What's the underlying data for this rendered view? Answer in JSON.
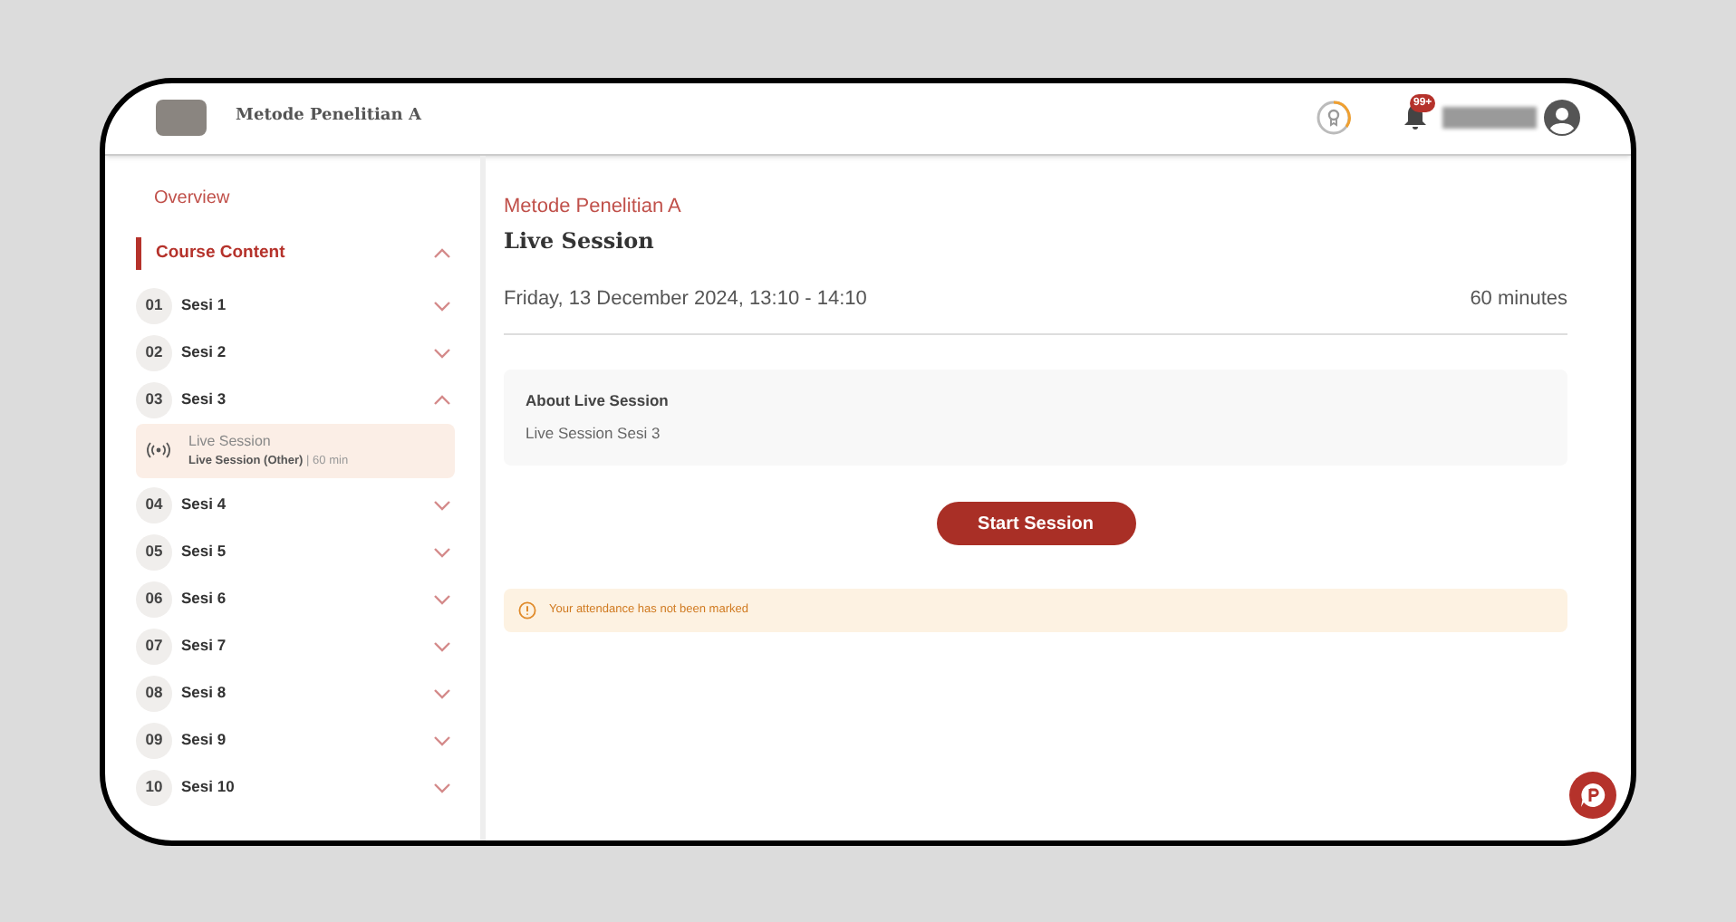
{
  "header": {
    "course_title": "Metode Penelitian A",
    "notification_count": "99+"
  },
  "sidebar": {
    "overview": "Overview",
    "section": {
      "label": "Course Content",
      "expanded": true
    },
    "sessions": [
      {
        "number": "01",
        "title": "Sesi 1",
        "expanded": false
      },
      {
        "number": "02",
        "title": "Sesi 2",
        "expanded": false
      },
      {
        "number": "03",
        "title": "Sesi 3",
        "expanded": true,
        "children": [
          {
            "title": "Live Session",
            "type": "Live Session (Other)",
            "separator": "|",
            "duration": "60 min",
            "selected": true
          }
        ]
      },
      {
        "number": "04",
        "title": "Sesi 4",
        "expanded": false
      },
      {
        "number": "05",
        "title": "Sesi 5",
        "expanded": false
      },
      {
        "number": "06",
        "title": "Sesi 6",
        "expanded": false
      },
      {
        "number": "07",
        "title": "Sesi 7",
        "expanded": false
      },
      {
        "number": "08",
        "title": "Sesi 8",
        "expanded": false
      },
      {
        "number": "09",
        "title": "Sesi 9",
        "expanded": false
      },
      {
        "number": "10",
        "title": "Sesi 10",
        "expanded": false
      }
    ]
  },
  "main": {
    "course": "Metode Penelitian A",
    "title": "Live Session",
    "schedule": "Friday, 13 December 2024, 13:10 - 14:10",
    "duration": "60 minutes",
    "about": {
      "heading": "About Live Session",
      "text": "Live Session Sesi 3"
    },
    "button": "Start Session",
    "notice": "Your attendance has not been marked"
  }
}
